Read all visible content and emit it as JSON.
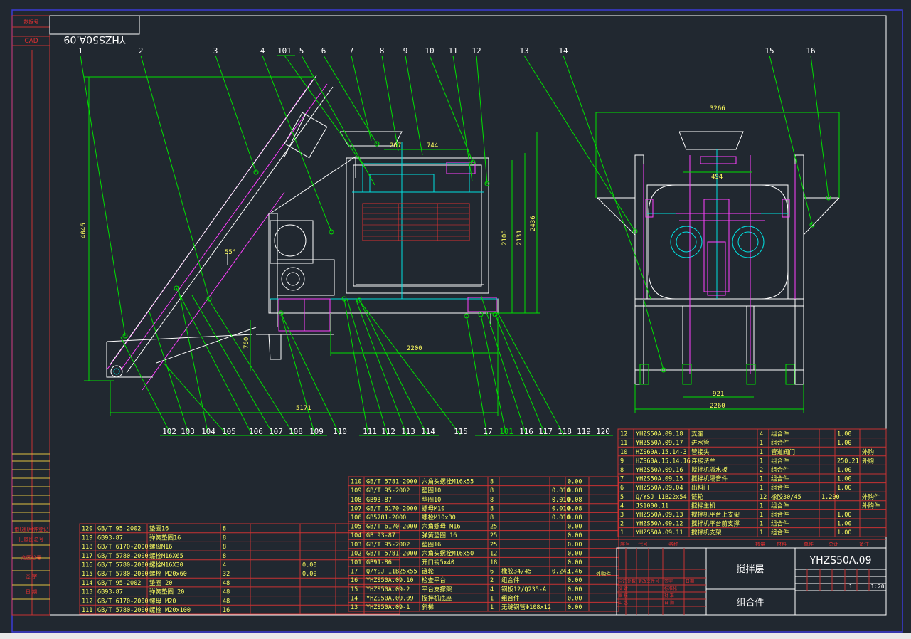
{
  "title_block": {
    "drawing_no_mirrored": "YHZS50A.09",
    "name": "搅拌层",
    "sub_name": "组合件",
    "code": "YHZS50A.09",
    "scale": "1:20",
    "qty": "1",
    "cells": [
      "标记",
      "处数",
      "更改文件号",
      "签字",
      "日期",
      "设 计",
      "标准化",
      "审 核",
      "工 艺",
      "批 准",
      "日 期"
    ]
  },
  "left_strip": {
    "top": [
      "数据号",
      "CAD"
    ],
    "bottom": [
      "借(通)用件登记",
      "旧底图总号",
      "底图总号",
      "签 字",
      "日 期"
    ]
  },
  "dimensions": [
    "267",
    "744",
    "3266",
    "494",
    "2100",
    "2131",
    "2436",
    "4046",
    "760",
    "2200",
    "5171",
    "921",
    "2260",
    "55°"
  ],
  "callouts_top": [
    "1",
    "2",
    "3",
    "4",
    "101",
    "5",
    "6",
    "7",
    "8",
    "9",
    "10",
    "11",
    "12",
    "13",
    "14",
    "15",
    "16"
  ],
  "callouts_bottom": [
    "102",
    "103",
    "104",
    "105",
    "106",
    "107",
    "108",
    "109",
    "110",
    "111",
    "112",
    "113",
    "114",
    "115",
    "17",
    "101",
    "116",
    "117",
    "118",
    "119",
    "120"
  ],
  "bom_left": [
    [
      "120",
      "GB/T 95-2002",
      "垫圈16",
      "8",
      "",
      ""
    ],
    [
      "119",
      "GB93-87",
      "弹簧垫圈16",
      "8",
      "",
      ""
    ],
    [
      "118",
      "GB/T 6170-2000",
      "螺母M16",
      "8",
      "",
      ""
    ],
    [
      "117",
      "GB/T 5780-2000",
      "螺栓M16X65",
      "8",
      "",
      ""
    ],
    [
      "116",
      "GB/T 5780-2000",
      "螺栓M16X30",
      "4",
      "",
      "0.00"
    ],
    [
      "115",
      "GB/T 5780-2000",
      "螺栓 M20x60",
      "32",
      "",
      "0.00"
    ],
    [
      "114",
      "GB/T 95-2002",
      "垫圈 20",
      "48",
      "",
      ""
    ],
    [
      "113",
      "GB93-87",
      "弹簧垫圈 20",
      "48",
      "",
      ""
    ],
    [
      "112",
      "GB/T 6170-2000",
      "螺母 M20",
      "48",
      "",
      ""
    ],
    [
      "111",
      "GB/T 5780-2000",
      "螺栓 M20x100",
      "16",
      "",
      ""
    ]
  ],
  "bom_mid": [
    [
      "110",
      "GB/T 5781-2000",
      "六角头螺栓M16x55",
      "8",
      "",
      "",
      "0.00"
    ],
    [
      "109",
      "GB/T 95-2002",
      "垫圈10",
      "8",
      "",
      "0.010",
      "0.08"
    ],
    [
      "108",
      "GB93-87",
      "垫圈10",
      "8",
      "",
      "0.010",
      "0.08"
    ],
    [
      "107",
      "GB/T 6170-2000",
      "螺母M10",
      "8",
      "",
      "0.010",
      "0.08"
    ],
    [
      "106",
      "GB5781-2000",
      "螺栓M10x30",
      "8",
      "",
      "0.010",
      "0.08"
    ],
    [
      "105",
      "GB/T 6170-2000",
      "六角螺母 M16",
      "25",
      "",
      "",
      "0.00"
    ],
    [
      "104",
      "GB 93-87",
      "弹簧垫圈 16",
      "25",
      "",
      "",
      "0.00"
    ],
    [
      "103",
      "GB/T 95-2002",
      "垫圈16",
      "25",
      "",
      "",
      "0.00"
    ],
    [
      "102",
      "GB/T 5781-2000",
      "六角头螺栓M16x50",
      "12",
      "",
      "",
      "0.00"
    ],
    [
      "101",
      "GB91-86",
      "开口销5x40",
      "18",
      "",
      "",
      "0.00"
    ],
    [
      "17",
      "Q/YSJ 11B25x55",
      "链轮",
      "6",
      "橡胶34/45",
      "0.243",
      "1.46"
    ],
    [
      "16",
      "YHZS50A.09.10",
      "检查平台",
      "2",
      "组合件",
      "",
      "0.00"
    ],
    [
      "15",
      "YHZS50A.09-2",
      "平台支撑架",
      "4",
      "钢板12/Q235-A",
      "",
      "0.00"
    ],
    [
      "14",
      "YHZS50A.09.09",
      "搅拌机底座",
      "1",
      "组合件",
      "",
      "0.00"
    ],
    [
      "13",
      "YHZS50A.09-1",
      "斜梯",
      "1",
      "无缝钢管Φ108x12",
      "",
      "0.00"
    ]
  ],
  "bom_mid_extra": {
    "17": "外购件"
  },
  "bom_right": [
    [
      "12",
      "YHZS50A.09.18",
      "支座",
      "4",
      "组合件",
      "",
      "1.00",
      ""
    ],
    [
      "11",
      "YHZS50A.09.17",
      "进水管",
      "1",
      "组合件",
      "",
      "1.00",
      ""
    ],
    [
      "10",
      "HZS60A.15.14-3",
      "管接头",
      "1",
      "管道阀门",
      "",
      "",
      "外购"
    ],
    [
      "9",
      "HZS60A.15.14.16",
      "连接法兰",
      "1",
      "组合件",
      "",
      "250.21",
      "外购"
    ],
    [
      "8",
      "YHZS50A.09.16",
      "搅拌机溢水板",
      "2",
      "组合件",
      "",
      "1.00",
      ""
    ],
    [
      "7",
      "YHZS50A.09.15",
      "搅拌机隔音件",
      "1",
      "组合件",
      "",
      "1.00",
      ""
    ],
    [
      "6",
      "YHZS50A.09.04",
      "出料门",
      "1",
      "组合件",
      "",
      "1.00",
      ""
    ],
    [
      "5",
      "Q/YSJ 11B22x54",
      "链轮",
      "12",
      "橡胶30/45",
      "1.200",
      "",
      "外购件"
    ],
    [
      "4",
      "JS1000.11",
      "搅拌主机",
      "1",
      "组合件",
      "",
      "",
      "外购件"
    ],
    [
      "3",
      "YHZS50A.09.13",
      "搅拌机平台上支架",
      "1",
      "组合件",
      "",
      "1.00",
      ""
    ],
    [
      "2",
      "YHZS50A.09.12",
      "搅拌机平台前支撑",
      "1",
      "组合件",
      "",
      "1.00",
      ""
    ],
    [
      "1",
      "YHZS50A.09.11",
      "搅拌机支架",
      "1",
      "组合件",
      "",
      "1.00",
      ""
    ]
  ],
  "bom_right_header": [
    "序号",
    "代号",
    "名称",
    "数量",
    "材料",
    "单件",
    "总计",
    "备注"
  ]
}
